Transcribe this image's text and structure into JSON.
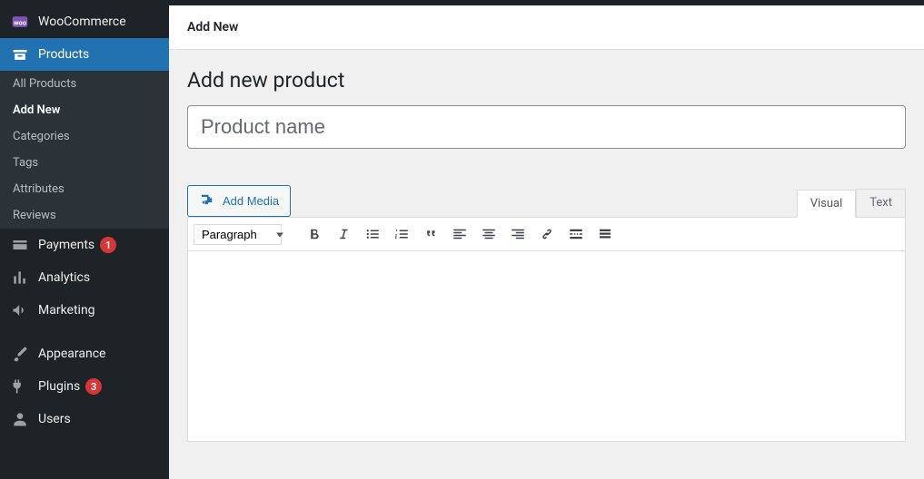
{
  "sidebar": {
    "woocommerce_label": "WooCommerce",
    "products_label": "Products",
    "sub": {
      "all_products": "All Products",
      "add_new": "Add New",
      "categories": "Categories",
      "tags": "Tags",
      "attributes": "Attributes",
      "reviews": "Reviews"
    },
    "payments": {
      "label": "Payments",
      "badge": "1"
    },
    "analytics_label": "Analytics",
    "marketing_label": "Marketing",
    "appearance_label": "Appearance",
    "plugins": {
      "label": "Plugins",
      "badge": "3"
    },
    "users_label": "Users"
  },
  "header": {
    "title": "Add New"
  },
  "page": {
    "heading": "Add new product",
    "title_placeholder": "Product name",
    "title_value": ""
  },
  "editor": {
    "add_media_label": "Add Media",
    "tab_visual": "Visual",
    "tab_text": "Text",
    "format_value": "Paragraph"
  }
}
